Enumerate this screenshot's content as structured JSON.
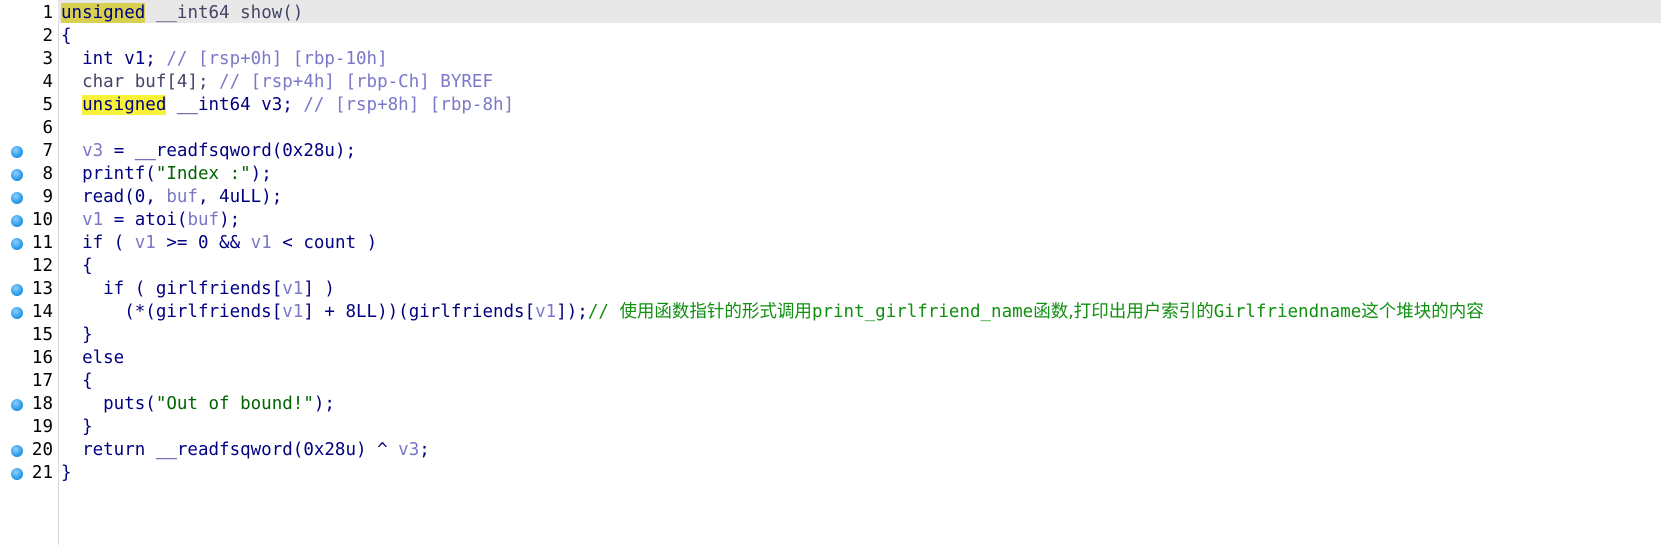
{
  "editor": {
    "lines": [
      {
        "n": "1",
        "bp": false,
        "parts": [
          {
            "t": "unsigned",
            "c": "hl hl-first"
          },
          {
            "t": " __int64 show()",
            "c": "gray"
          }
        ]
      },
      {
        "n": "2",
        "bp": false,
        "parts": [
          {
            "t": "{",
            "c": "kw"
          }
        ]
      },
      {
        "n": "3",
        "bp": false,
        "parts": [
          {
            "t": "  int v1; ",
            "c": "kw"
          },
          {
            "t": "// [rsp+0h] [rbp-10h]",
            "c": "cmt"
          }
        ]
      },
      {
        "n": "4",
        "bp": false,
        "parts": [
          {
            "t": "  char buf[4]; ",
            "c": "gray"
          },
          {
            "t": "// [rsp+4h] [rbp-Ch] BYREF",
            "c": "cmt"
          }
        ]
      },
      {
        "n": "5",
        "bp": false,
        "parts": [
          {
            "t": "  ",
            "c": "kw"
          },
          {
            "t": "unsigned",
            "c": "hl"
          },
          {
            "t": " __int64 v3; ",
            "c": "kw"
          },
          {
            "t": "// [rsp+8h] [rbp-8h]",
            "c": "cmt"
          }
        ]
      },
      {
        "n": "6",
        "bp": false,
        "parts": []
      },
      {
        "n": "7",
        "bp": true,
        "parts": [
          {
            "t": "  ",
            "c": "kw"
          },
          {
            "t": "v3",
            "c": "var"
          },
          {
            "t": " = __readfsqword(0x28u);",
            "c": "kw"
          }
        ]
      },
      {
        "n": "8",
        "bp": true,
        "parts": [
          {
            "t": "  printf(",
            "c": "kw"
          },
          {
            "t": "\"Index :\"",
            "c": "str"
          },
          {
            "t": ");",
            "c": "kw"
          }
        ]
      },
      {
        "n": "9",
        "bp": true,
        "parts": [
          {
            "t": "  read(0, ",
            "c": "kw"
          },
          {
            "t": "buf",
            "c": "var"
          },
          {
            "t": ", 4uLL);",
            "c": "kw"
          }
        ]
      },
      {
        "n": "10",
        "bp": true,
        "parts": [
          {
            "t": "  ",
            "c": "kw"
          },
          {
            "t": "v1",
            "c": "var"
          },
          {
            "t": " = atoi(",
            "c": "kw"
          },
          {
            "t": "buf",
            "c": "var"
          },
          {
            "t": ");",
            "c": "kw"
          }
        ]
      },
      {
        "n": "11",
        "bp": true,
        "parts": [
          {
            "t": "  if ( ",
            "c": "kw"
          },
          {
            "t": "v1",
            "c": "var"
          },
          {
            "t": " >= 0 && ",
            "c": "kw"
          },
          {
            "t": "v1",
            "c": "var"
          },
          {
            "t": " < count )",
            "c": "kw"
          }
        ]
      },
      {
        "n": "12",
        "bp": false,
        "parts": [
          {
            "t": "  {",
            "c": "kw"
          }
        ]
      },
      {
        "n": "13",
        "bp": true,
        "parts": [
          {
            "t": "    if ( girlfriends[",
            "c": "kw"
          },
          {
            "t": "v1",
            "c": "var"
          },
          {
            "t": "] )",
            "c": "kw"
          }
        ]
      },
      {
        "n": "14",
        "bp": true,
        "parts": [
          {
            "t": "      (*(girlfriends[",
            "c": "kw"
          },
          {
            "t": "v1",
            "c": "var"
          },
          {
            "t": "] + 8LL))(girlfriends[",
            "c": "kw"
          },
          {
            "t": "v1",
            "c": "var"
          },
          {
            "t": "]);",
            "c": "kw"
          },
          {
            "t": "// ",
            "c": "cn-mono"
          },
          {
            "t": "使用函数指针的形式调用",
            "c": "cn"
          },
          {
            "t": "print_girlfriend_name",
            "c": "cn-mono"
          },
          {
            "t": "函数,打印出用户索引的",
            "c": "cn"
          },
          {
            "t": "Girlfriendname",
            "c": "cn-mono"
          },
          {
            "t": "这个堆块的内容",
            "c": "cn"
          }
        ]
      },
      {
        "n": "15",
        "bp": false,
        "parts": [
          {
            "t": "  }",
            "c": "kw"
          }
        ]
      },
      {
        "n": "16",
        "bp": false,
        "parts": [
          {
            "t": "  else",
            "c": "kw"
          }
        ]
      },
      {
        "n": "17",
        "bp": false,
        "parts": [
          {
            "t": "  {",
            "c": "kw"
          }
        ]
      },
      {
        "n": "18",
        "bp": true,
        "parts": [
          {
            "t": "    puts(",
            "c": "kw"
          },
          {
            "t": "\"Out of bound!\"",
            "c": "str"
          },
          {
            "t": ");",
            "c": "kw"
          }
        ]
      },
      {
        "n": "19",
        "bp": false,
        "parts": [
          {
            "t": "  }",
            "c": "kw"
          }
        ]
      },
      {
        "n": "20",
        "bp": true,
        "parts": [
          {
            "t": "  return __readfsqword(0x28u) ^ ",
            "c": "kw"
          },
          {
            "t": "v3",
            "c": "var"
          },
          {
            "t": ";",
            "c": "kw"
          }
        ]
      },
      {
        "n": "21",
        "bp": true,
        "parts": [
          {
            "t": "}",
            "c": "kw"
          }
        ]
      }
    ]
  }
}
